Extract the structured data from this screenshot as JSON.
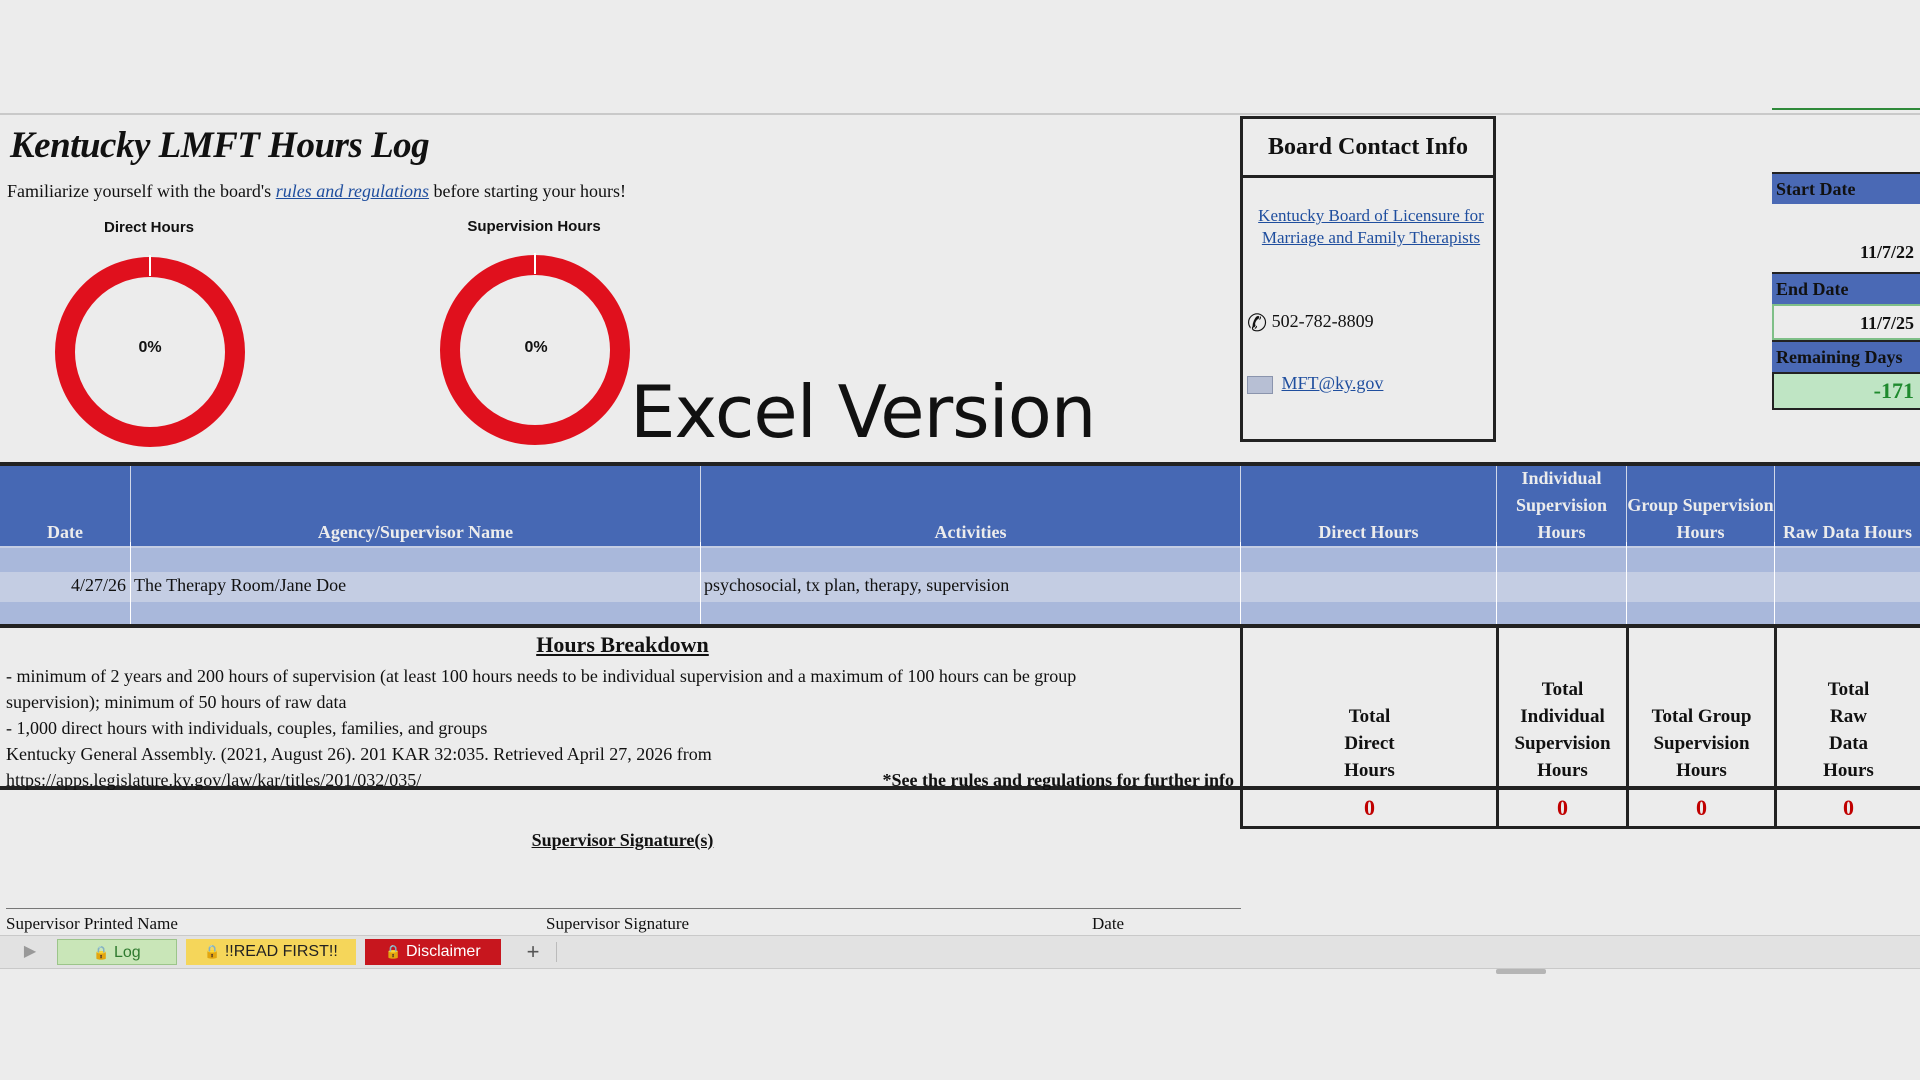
{
  "header": {
    "title": "Kentucky LMFT Hours Log",
    "subtitle_pre": "Familiarize yourself with the board's ",
    "subtitle_link": "rules and regulations",
    "subtitle_post": " before starting your hours!"
  },
  "gauges": [
    {
      "title": "Direct Hours",
      "percent_label": "0%",
      "value": 0
    },
    {
      "title": "Supervision Hours",
      "percent_label": "0%",
      "value": 0
    }
  ],
  "overlay_text": "Excel Version",
  "board": {
    "title": "Board Contact Info",
    "link": "Kentucky Board of Licensure for Marriage and Family Therapists",
    "phone": "502-782-8809",
    "email": "MFT@ky.gov"
  },
  "dates": {
    "start_label": "Start Date",
    "start_value": "11/7/22",
    "end_label": "End Date",
    "end_value": "11/7/25",
    "remaining_label": "Remaining Days",
    "remaining_value": "-171"
  },
  "table": {
    "headers": [
      "Date",
      "Agency/Supervisor Name",
      "Activities",
      "Direct Hours",
      "Individual Supervision Hours",
      "Group Supervision Hours",
      "Raw Data Hours"
    ],
    "rows": [
      [
        "",
        "",
        "",
        "",
        "",
        "",
        ""
      ],
      [
        "4/27/26",
        "The Therapy Room/Jane Doe",
        "psychosocial, tx plan, therapy, supervision",
        "",
        "",
        "",
        ""
      ],
      [
        "",
        "",
        "",
        "",
        "",
        "",
        ""
      ]
    ]
  },
  "breakdown": {
    "title": "Hours Breakdown",
    "line1": "- minimum of 2 years and 200 hours of supervision (at least 100 hours needs to be individual supervision and a maximum of 100 hours can be group",
    "line2": "supervision); minimum of 50 hours of raw data",
    "line3": "- 1,000 direct hours with individuals, couples, families, and groups",
    "line4": "Kentucky General Assembly. (2021, August 26). 201 KAR 32:035. Retrieved April 27, 2026 from",
    "line5": "https://apps.legislature.ky.gov/law/kar/titles/201/032/035/",
    "note": "*See the rules and regulations for further info"
  },
  "totals": {
    "labels": [
      "Total Direct Hours",
      "Total Individual Supervision Hours",
      "Total Group Supervision Hours",
      "Total Raw Data Hours"
    ],
    "values": [
      "0",
      "0",
      "0",
      "0"
    ]
  },
  "signature": {
    "title": "Supervisor Signature(s)",
    "printed_name": "Supervisor Printed Name",
    "signature": "Supervisor Signature",
    "date": "Date"
  },
  "tabs": [
    {
      "label": "Log",
      "color": "#c9e6b8",
      "text_color": "#2f7a2f"
    },
    {
      "label": "!!READ FIRST!!",
      "color": "#f5d65a",
      "text_color": "#222222"
    },
    {
      "label": "Disclaimer",
      "color": "#c7161e",
      "text_color": "#ffffff"
    }
  ],
  "add_sheet": "+",
  "colors": {
    "header_blue": "#4668b4",
    "gauge_red": "#e0101d",
    "row_light": "#c4cde3",
    "row_mid": "#a9b8db"
  }
}
